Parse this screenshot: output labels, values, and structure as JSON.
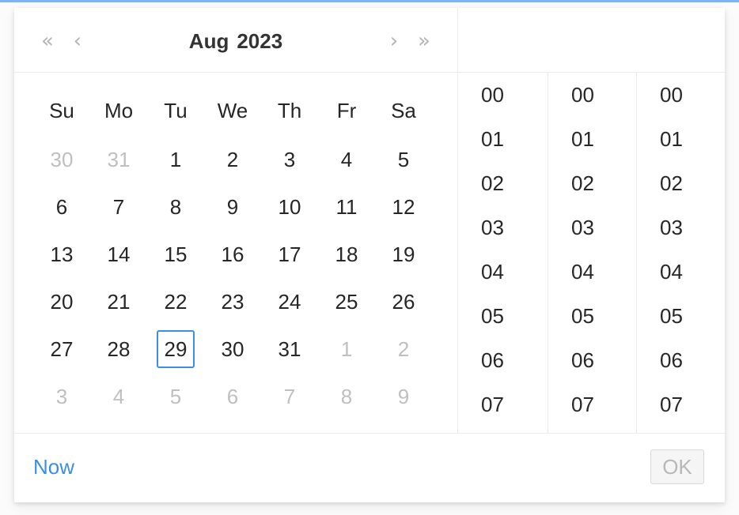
{
  "calendar": {
    "month": "Aug",
    "year": "2023",
    "nav": {
      "super_prev": "«",
      "prev": "‹",
      "next": "›",
      "super_next": "»"
    },
    "weekdays": [
      "Su",
      "Mo",
      "Tu",
      "We",
      "Th",
      "Fr",
      "Sa"
    ],
    "weeks": [
      [
        {
          "d": "30",
          "other": true
        },
        {
          "d": "31",
          "other": true
        },
        {
          "d": "1"
        },
        {
          "d": "2"
        },
        {
          "d": "3"
        },
        {
          "d": "4"
        },
        {
          "d": "5"
        }
      ],
      [
        {
          "d": "6"
        },
        {
          "d": "7"
        },
        {
          "d": "8"
        },
        {
          "d": "9"
        },
        {
          "d": "10"
        },
        {
          "d": "11"
        },
        {
          "d": "12"
        }
      ],
      [
        {
          "d": "13"
        },
        {
          "d": "14"
        },
        {
          "d": "15"
        },
        {
          "d": "16"
        },
        {
          "d": "17"
        },
        {
          "d": "18"
        },
        {
          "d": "19"
        }
      ],
      [
        {
          "d": "20"
        },
        {
          "d": "21"
        },
        {
          "d": "22"
        },
        {
          "d": "23"
        },
        {
          "d": "24"
        },
        {
          "d": "25"
        },
        {
          "d": "26"
        }
      ],
      [
        {
          "d": "27"
        },
        {
          "d": "28"
        },
        {
          "d": "29",
          "today": true
        },
        {
          "d": "30"
        },
        {
          "d": "31"
        },
        {
          "d": "1",
          "other": true
        },
        {
          "d": "2",
          "other": true
        }
      ],
      [
        {
          "d": "3",
          "other": true
        },
        {
          "d": "4",
          "other": true
        },
        {
          "d": "5",
          "other": true
        },
        {
          "d": "6",
          "other": true
        },
        {
          "d": "7",
          "other": true
        },
        {
          "d": "8",
          "other": true
        },
        {
          "d": "9",
          "other": true
        }
      ]
    ]
  },
  "time": {
    "hours": [
      "00",
      "01",
      "02",
      "03",
      "04",
      "05",
      "06",
      "07"
    ],
    "minutes": [
      "00",
      "01",
      "02",
      "03",
      "04",
      "05",
      "06",
      "07"
    ],
    "seconds": [
      "00",
      "01",
      "02",
      "03",
      "04",
      "05",
      "06",
      "07"
    ]
  },
  "footer": {
    "now_label": "Now",
    "ok_label": "OK"
  },
  "colors": {
    "accent": "#3c8ee4",
    "muted_text": "#bfbfbf",
    "focus_strip": "#7fb5ee"
  }
}
